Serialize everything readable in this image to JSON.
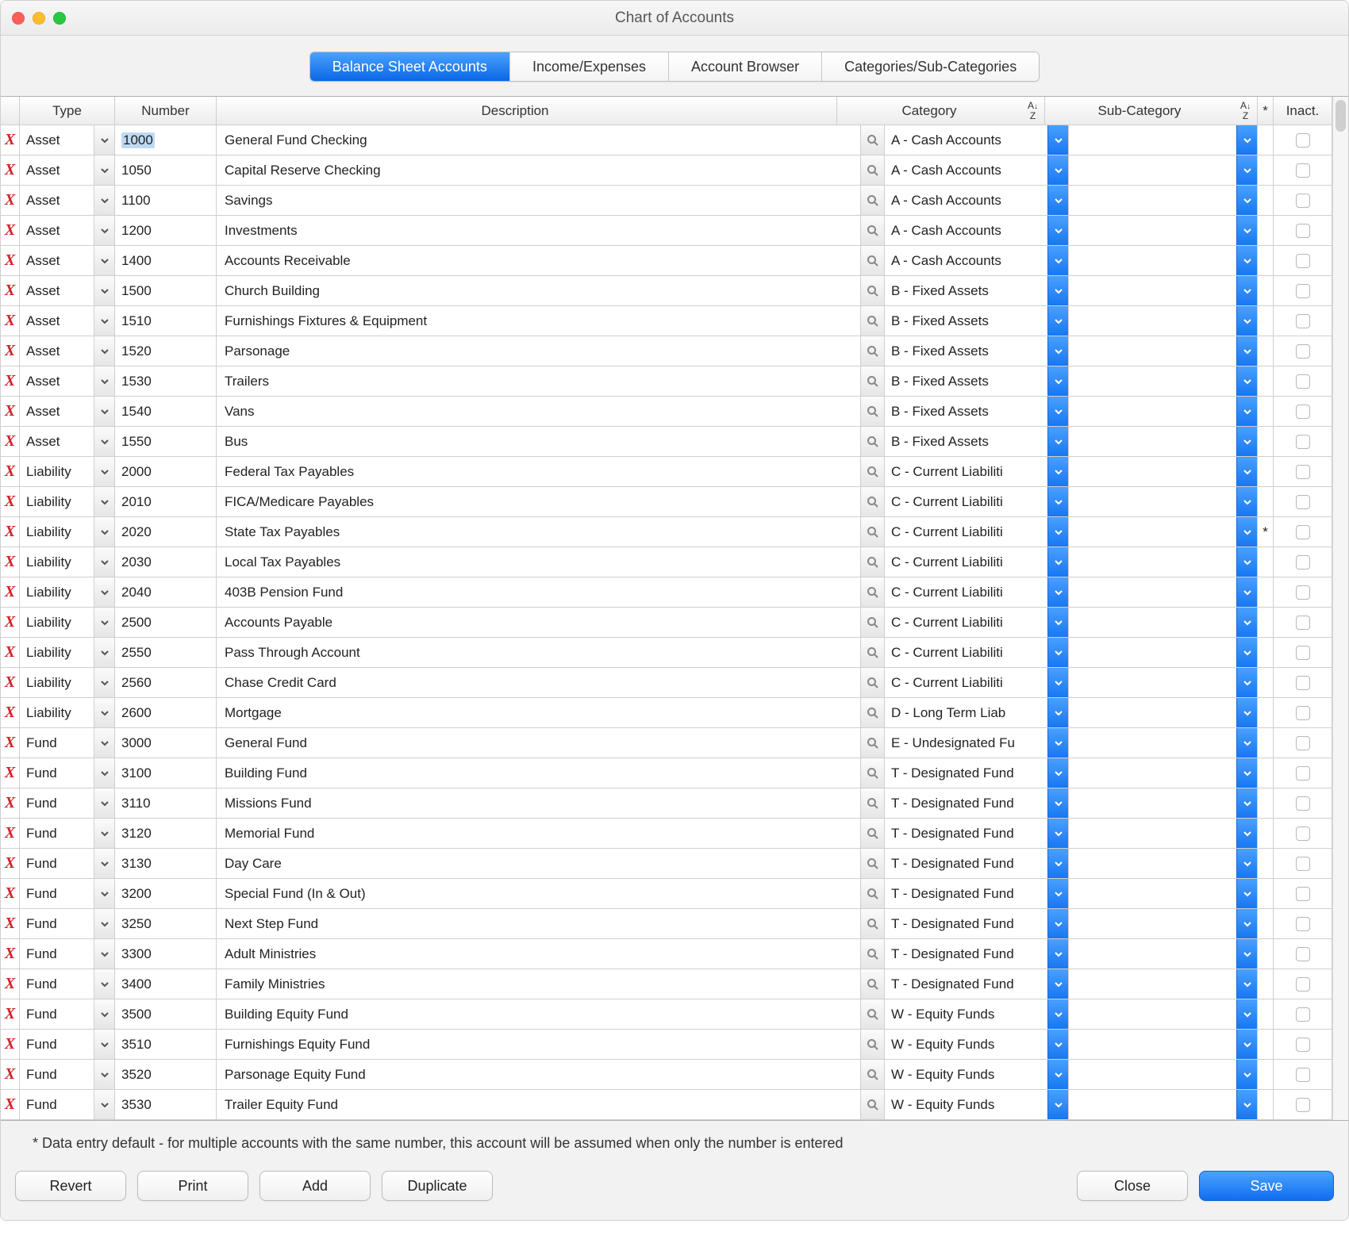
{
  "window_title": "Chart of Accounts",
  "tabs": [
    "Balance Sheet Accounts",
    "Income/Expenses",
    "Account Browser",
    "Categories/Sub-Categories"
  ],
  "active_tab": 0,
  "columns": {
    "type": "Type",
    "number": "Number",
    "description": "Description",
    "category": "Category",
    "sub": "Sub-Category",
    "star": "*",
    "inact": "Inact."
  },
  "rows": [
    {
      "type": "Asset",
      "number": "1000",
      "number_selected": true,
      "desc": "General Fund Checking",
      "cat": "A - Cash Accounts",
      "sub": "",
      "star": "",
      "inact": false
    },
    {
      "type": "Asset",
      "number": "1050",
      "desc": "Capital Reserve Checking",
      "cat": "A - Cash Accounts",
      "sub": "",
      "star": "",
      "inact": false
    },
    {
      "type": "Asset",
      "number": "1100",
      "desc": "Savings",
      "cat": "A - Cash Accounts",
      "sub": "",
      "star": "",
      "inact": false
    },
    {
      "type": "Asset",
      "number": "1200",
      "desc": "Investments",
      "cat": "A - Cash Accounts",
      "sub": "",
      "star": "",
      "inact": false
    },
    {
      "type": "Asset",
      "number": "1400",
      "desc": "Accounts Receivable",
      "cat": "A - Cash Accounts",
      "sub": "",
      "star": "",
      "inact": false
    },
    {
      "type": "Asset",
      "number": "1500",
      "desc": "Church Building",
      "cat": "B - Fixed Assets",
      "sub": "",
      "star": "",
      "inact": false
    },
    {
      "type": "Asset",
      "number": "1510",
      "desc": "Furnishings Fixtures & Equipment",
      "cat": "B - Fixed Assets",
      "sub": "",
      "star": "",
      "inact": false
    },
    {
      "type": "Asset",
      "number": "1520",
      "desc": "Parsonage",
      "cat": "B - Fixed Assets",
      "sub": "",
      "star": "",
      "inact": false
    },
    {
      "type": "Asset",
      "number": "1530",
      "desc": "Trailers",
      "cat": "B - Fixed Assets",
      "sub": "",
      "star": "",
      "inact": false
    },
    {
      "type": "Asset",
      "number": "1540",
      "desc": "Vans",
      "cat": "B - Fixed Assets",
      "sub": "",
      "star": "",
      "inact": false
    },
    {
      "type": "Asset",
      "number": "1550",
      "desc": "Bus",
      "cat": "B - Fixed Assets",
      "sub": "",
      "star": "",
      "inact": false
    },
    {
      "type": "Liability",
      "number": "2000",
      "desc": "Federal Tax Payables",
      "cat": "C - Current Liabiliti",
      "sub": "",
      "star": "",
      "inact": false
    },
    {
      "type": "Liability",
      "number": "2010",
      "desc": "FICA/Medicare Payables",
      "cat": "C - Current Liabiliti",
      "sub": "",
      "star": "",
      "inact": false
    },
    {
      "type": "Liability",
      "number": "2020",
      "desc": "State Tax Payables",
      "cat": "C - Current Liabiliti",
      "sub": "",
      "star": "*",
      "inact": false
    },
    {
      "type": "Liability",
      "number": "2030",
      "desc": "Local Tax Payables",
      "cat": "C - Current Liabiliti",
      "sub": "",
      "star": "",
      "inact": false
    },
    {
      "type": "Liability",
      "number": "2040",
      "desc": "403B Pension Fund",
      "cat": "C - Current Liabiliti",
      "sub": "",
      "star": "",
      "inact": false
    },
    {
      "type": "Liability",
      "number": "2500",
      "desc": "Accounts Payable",
      "cat": "C - Current Liabiliti",
      "sub": "",
      "star": "",
      "inact": false
    },
    {
      "type": "Liability",
      "number": "2550",
      "desc": "Pass Through Account",
      "cat": "C - Current Liabiliti",
      "sub": "",
      "star": "",
      "inact": false
    },
    {
      "type": "Liability",
      "number": "2560",
      "desc": "Chase Credit Card",
      "cat": "C - Current Liabiliti",
      "sub": "",
      "star": "",
      "inact": false
    },
    {
      "type": "Liability",
      "number": "2600",
      "desc": "Mortgage",
      "cat": "D - Long Term Liab",
      "sub": "",
      "star": "",
      "inact": false
    },
    {
      "type": "Fund",
      "number": "3000",
      "desc": "General Fund",
      "cat": "E - Undesignated Fu",
      "sub": "",
      "star": "",
      "inact": false
    },
    {
      "type": "Fund",
      "number": "3100",
      "desc": "Building Fund",
      "cat": "T - Designated Fund",
      "sub": "",
      "star": "",
      "inact": false
    },
    {
      "type": "Fund",
      "number": "3110",
      "desc": "Missions Fund",
      "cat": "T - Designated Fund",
      "sub": "",
      "star": "",
      "inact": false
    },
    {
      "type": "Fund",
      "number": "3120",
      "desc": "Memorial Fund",
      "cat": "T - Designated Fund",
      "sub": "",
      "star": "",
      "inact": false
    },
    {
      "type": "Fund",
      "number": "3130",
      "desc": "Day Care",
      "cat": "T - Designated Fund",
      "sub": "",
      "star": "",
      "inact": false
    },
    {
      "type": "Fund",
      "number": "3200",
      "desc": "Special Fund (In & Out)",
      "cat": "T - Designated Fund",
      "sub": "",
      "star": "",
      "inact": false
    },
    {
      "type": "Fund",
      "number": "3250",
      "desc": "Next Step Fund",
      "cat": "T - Designated Fund",
      "sub": "",
      "star": "",
      "inact": false
    },
    {
      "type": "Fund",
      "number": "3300",
      "desc": "Adult Ministries",
      "cat": "T - Designated Fund",
      "sub": "",
      "star": "",
      "inact": false
    },
    {
      "type": "Fund",
      "number": "3400",
      "desc": "Family Ministries",
      "cat": "T - Designated Fund",
      "sub": "",
      "star": "",
      "inact": false
    },
    {
      "type": "Fund",
      "number": "3500",
      "desc": "Building Equity Fund",
      "cat": "W - Equity Funds",
      "sub": "",
      "star": "",
      "inact": false
    },
    {
      "type": "Fund",
      "number": "3510",
      "desc": "Furnishings Equity Fund",
      "cat": "W - Equity Funds",
      "sub": "",
      "star": "",
      "inact": false
    },
    {
      "type": "Fund",
      "number": "3520",
      "desc": "Parsonage Equity Fund",
      "cat": "W - Equity Funds",
      "sub": "",
      "star": "",
      "inact": false
    },
    {
      "type": "Fund",
      "number": "3530",
      "desc": "Trailer Equity Fund",
      "cat": "W - Equity Funds",
      "sub": "",
      "star": "",
      "inact": false
    }
  ],
  "footnote": "* Data entry default - for multiple accounts with the same number, this account will be assumed when only the number is entered",
  "buttons": {
    "revert": "Revert",
    "print": "Print",
    "add": "Add",
    "duplicate": "Duplicate",
    "close": "Close",
    "save": "Save"
  }
}
